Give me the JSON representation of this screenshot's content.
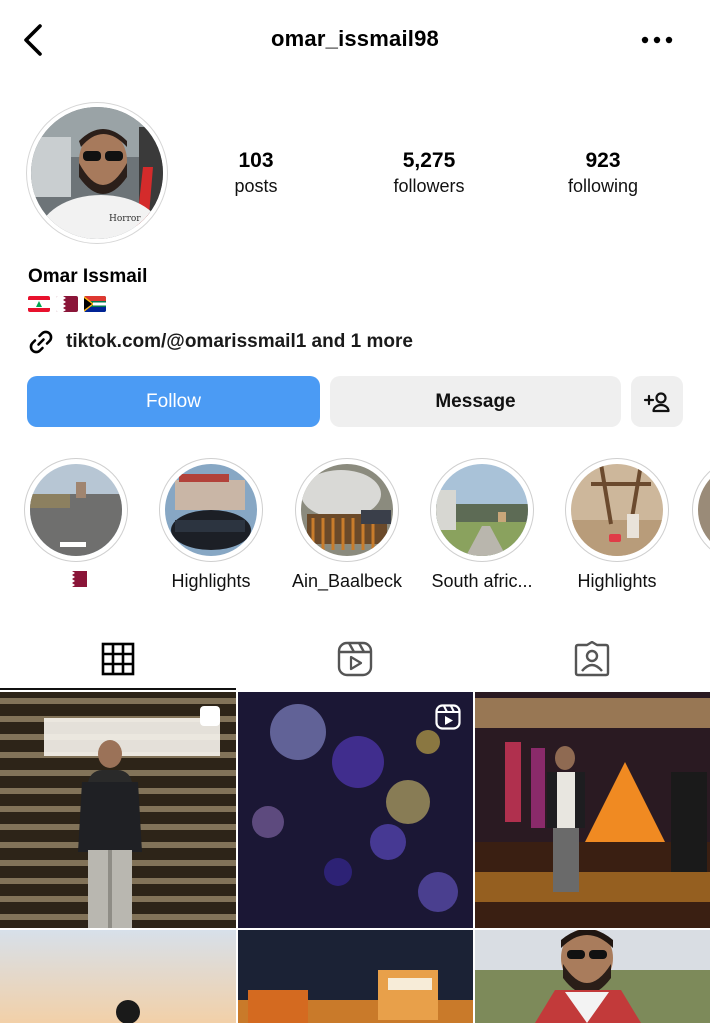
{
  "header": {
    "username": "omar_issmail98",
    "back_icon": "chevron-left-icon",
    "more_icon": "more-horizontal-icon"
  },
  "profile": {
    "stats": [
      {
        "value": "103",
        "label": "posts"
      },
      {
        "value": "5,275",
        "label": "followers"
      },
      {
        "value": "923",
        "label": "following"
      }
    ],
    "full_name": "Omar Issmail",
    "flags": [
      "lebanon-flag",
      "qatar-flag",
      "south-africa-flag"
    ],
    "link_text": "tiktok.com/@omarissmail1 and 1 more"
  },
  "actions": {
    "follow_label": "Follow",
    "message_label": "Message",
    "add_person_icon": "add-person-icon"
  },
  "highlights": [
    {
      "label": ""
    },
    {
      "label": "Highlights"
    },
    {
      "label": "Ain_Baalbeck"
    },
    {
      "label": "South afric..."
    },
    {
      "label": "Highlights"
    }
  ],
  "tabs": [
    {
      "icon": "grid-icon",
      "active": true
    },
    {
      "icon": "reels-icon",
      "active": false
    },
    {
      "icon": "tagged-icon",
      "active": false
    }
  ],
  "colors": {
    "follow_blue": "#4b9bf4",
    "button_gray": "#efefef",
    "text": "#000000"
  }
}
